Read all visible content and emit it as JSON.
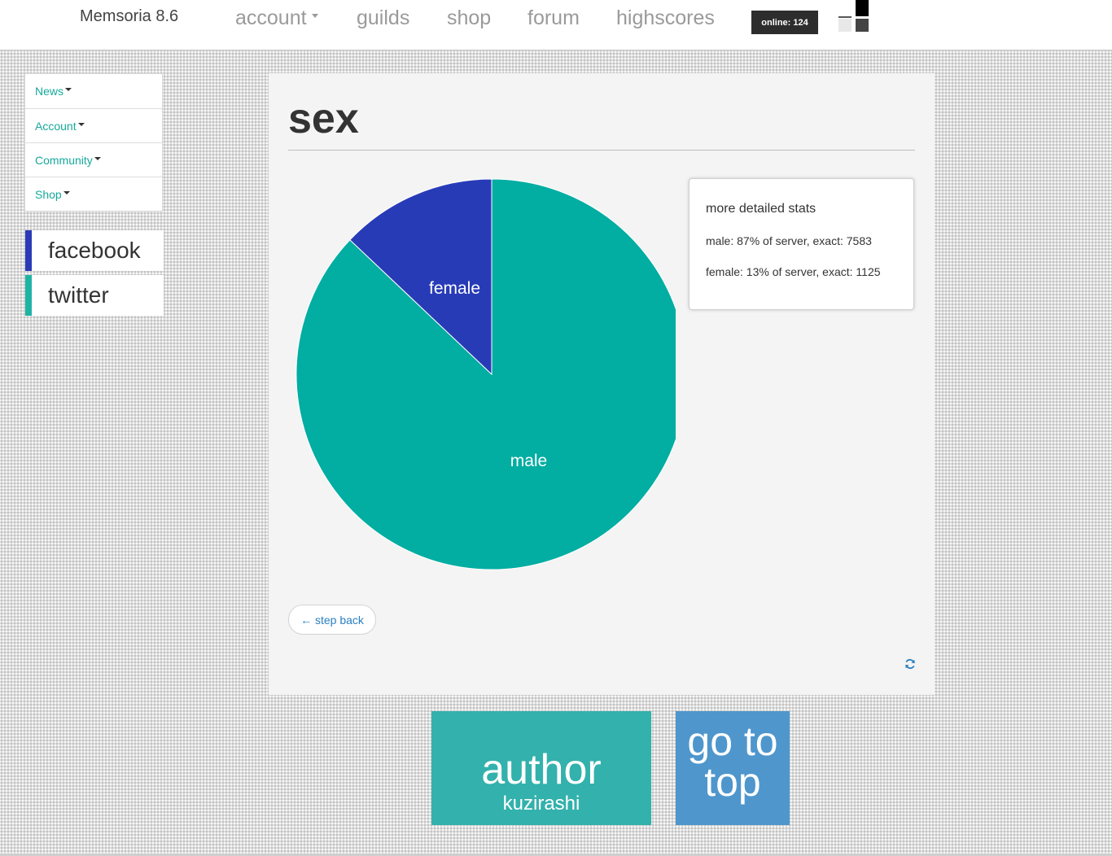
{
  "header": {
    "brand": "Memsoria 8.6",
    "nav": [
      {
        "label": "account"
      },
      {
        "label": "guilds"
      },
      {
        "label": "shop"
      },
      {
        "label": "forum"
      },
      {
        "label": "highscores"
      }
    ],
    "online_badge": "online: 124"
  },
  "sidebar": {
    "items": [
      {
        "label": "News"
      },
      {
        "label": "Account"
      },
      {
        "label": "Community"
      },
      {
        "label": "Shop"
      }
    ],
    "social": [
      {
        "label": "facebook",
        "color": "#2a3bb5"
      },
      {
        "label": "twitter",
        "color": "#1fb3a4"
      }
    ]
  },
  "main": {
    "title": "sex",
    "stats": {
      "heading": "more detailed stats",
      "lines": [
        "male: 87% of server, exact: 7583",
        "female: 13% of server, exact: 1125"
      ]
    },
    "back_button": "← step back",
    "refresh_icon": "refresh-icon"
  },
  "footer": {
    "author_title": "author",
    "author_name": "kuzirashi",
    "go_top": "go to top"
  },
  "colors": {
    "accent": "#16a99c",
    "male": "#02ada2",
    "female": "#283bb7"
  },
  "chart_data": {
    "type": "pie",
    "categories": [
      "male",
      "female"
    ],
    "values": [
      7583,
      1125
    ],
    "colors": [
      "#02ada2",
      "#283bb7"
    ]
  }
}
